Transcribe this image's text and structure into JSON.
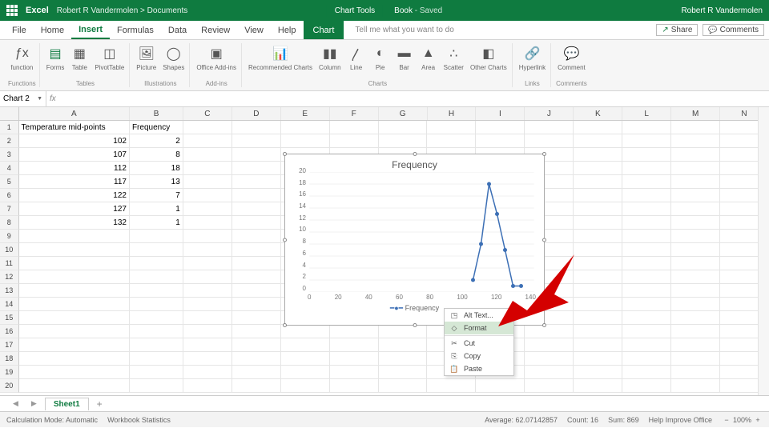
{
  "titlebar": {
    "appname": "Excel",
    "breadcrumb": "Robert R Vandermolen > Documents",
    "chart_tools": "Chart Tools",
    "book": "Book",
    "saved": "- Saved",
    "user": "Robert R Vandermolen"
  },
  "tabs": {
    "file": "File",
    "home": "Home",
    "insert": "Insert",
    "formulas": "Formulas",
    "data": "Data",
    "review": "Review",
    "view": "View",
    "help": "Help",
    "chart": "Chart",
    "tellme": "Tell me what you want to do",
    "share": "Share",
    "comments": "Comments"
  },
  "ribbon": {
    "function": "function",
    "forms": "Forms",
    "table": "Table",
    "pivottable": "PivotTable",
    "picture": "Picture",
    "shapes": "Shapes",
    "office_addins": "Office Add-ins",
    "recommended_charts": "Recommended Charts",
    "column": "Column",
    "line": "Line",
    "pie": "Pie",
    "bar": "Bar",
    "area": "Area",
    "scatter": "Scatter",
    "other_charts": "Other Charts",
    "hyperlink": "Hyperlink",
    "comment": "Comment",
    "group_functions": "Functions",
    "group_tables": "Tables",
    "group_illustrations": "Illustrations",
    "group_addins": "Add-ins",
    "group_charts": "Charts",
    "group_links": "Links",
    "group_comments": "Comments"
  },
  "formula": {
    "namebox": "Chart 2",
    "fx": "fx"
  },
  "columns": [
    "A",
    "B",
    "C",
    "D",
    "E",
    "F",
    "G",
    "H",
    "I",
    "J",
    "K",
    "L",
    "M",
    "N"
  ],
  "grid": {
    "header_a": "Temperature mid-points",
    "header_b": "Frequency",
    "rows": [
      {
        "a": "102",
        "b": "2"
      },
      {
        "a": "107",
        "b": "8"
      },
      {
        "a": "112",
        "b": "18"
      },
      {
        "a": "117",
        "b": "13"
      },
      {
        "a": "122",
        "b": "7"
      },
      {
        "a": "127",
        "b": "1"
      },
      {
        "a": "132",
        "b": "1"
      }
    ]
  },
  "chart": {
    "title": "Frequency",
    "y_ticks": [
      "20",
      "18",
      "16",
      "14",
      "12",
      "10",
      "8",
      "6",
      "4",
      "2",
      "0"
    ],
    "x_ticks": [
      "0",
      "20",
      "40",
      "60",
      "80",
      "100",
      "120",
      "140"
    ],
    "legend": "Frequency"
  },
  "chart_data": {
    "type": "scatter",
    "title": "Frequency",
    "xlabel": "",
    "ylabel": "",
    "x": [
      102,
      107,
      112,
      117,
      122,
      127,
      132
    ],
    "y": [
      2,
      8,
      18,
      13,
      7,
      1,
      1
    ],
    "series": [
      {
        "name": "Frequency",
        "values": [
          2,
          8,
          18,
          13,
          7,
          1,
          1
        ]
      }
    ],
    "xlim": [
      0,
      140
    ],
    "ylim": [
      0,
      20
    ]
  },
  "context_menu": {
    "alt_text": "Alt Text...",
    "format": "Format",
    "cut": "Cut",
    "copy": "Copy",
    "paste": "Paste"
  },
  "sheet_tabs": {
    "sheet1": "Sheet1"
  },
  "status": {
    "calc": "Calculation Mode: Automatic",
    "stats": "Workbook Statistics",
    "avg": "Average: 62.07142857",
    "count": "Count: 16",
    "sum": "Sum: 869",
    "help": "Help Improve Office",
    "zoom": "100%"
  }
}
